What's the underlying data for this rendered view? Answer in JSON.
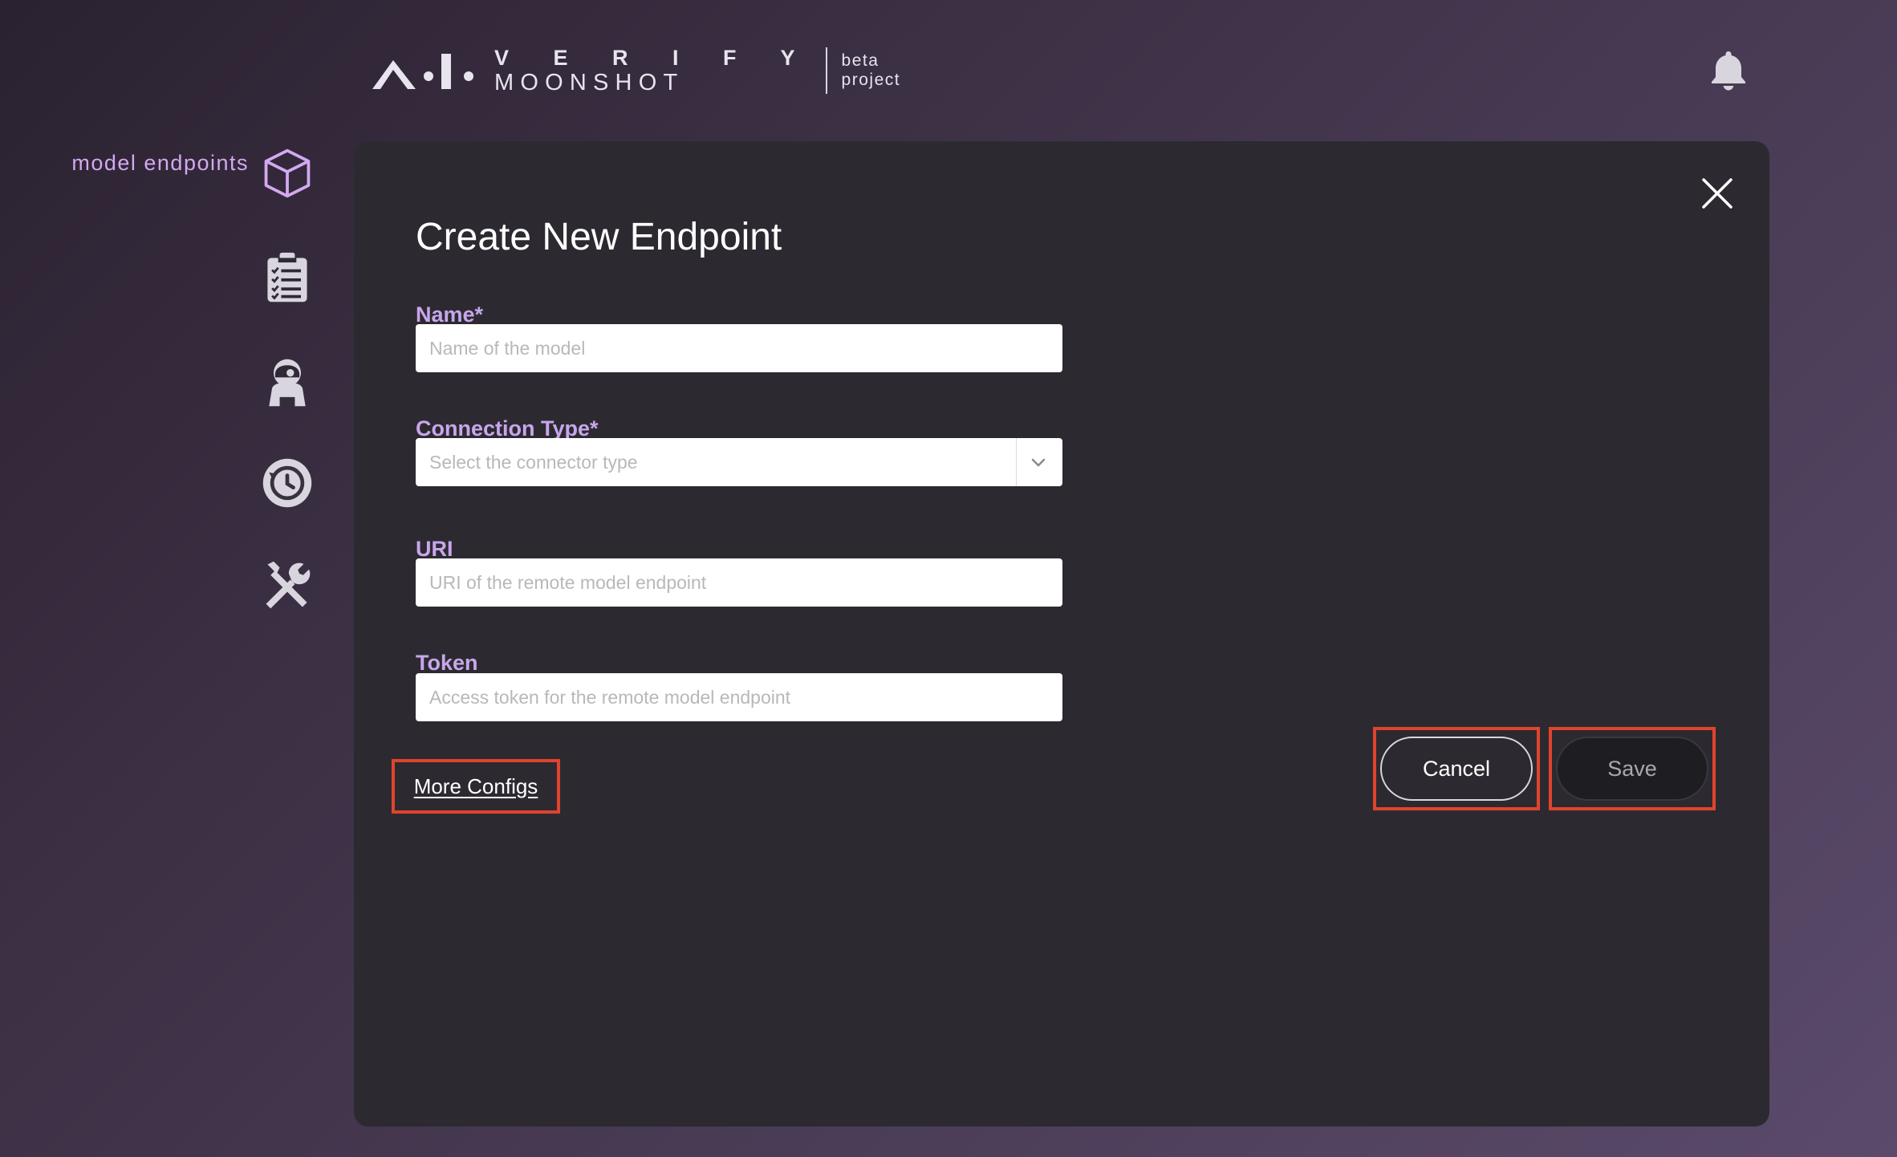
{
  "header": {
    "logo": {
      "line1": "V E R I F Y",
      "line2": "MOONSHOT",
      "tag_line1": "beta",
      "tag_line2": "project"
    },
    "bell_icon": "bell-icon"
  },
  "sidebar": {
    "active_label": "model endpoints",
    "items": [
      {
        "icon": "cube-icon",
        "active": true
      },
      {
        "icon": "clipboard-checklist-icon"
      },
      {
        "icon": "astronaut-icon"
      },
      {
        "icon": "history-clock-icon"
      },
      {
        "icon": "tools-icon"
      }
    ]
  },
  "modal": {
    "title": "Create New Endpoint",
    "close_icon": "close-icon",
    "fields": {
      "name": {
        "label": "Name*",
        "placeholder": "Name of the model",
        "value": ""
      },
      "connection_type": {
        "label": "Connection Type*",
        "placeholder": "Select the connector type",
        "value": ""
      },
      "uri": {
        "label": "URI",
        "placeholder": "URI of the remote model endpoint",
        "value": ""
      },
      "token": {
        "label": "Token",
        "placeholder": "Access token for the remote model endpoint",
        "value": ""
      }
    },
    "more_configs_label": "More Configs",
    "cancel_label": "Cancel",
    "save_label": "Save"
  },
  "colors": {
    "accent": "#c8a6ec",
    "highlight_box": "#e0442c",
    "modal_bg": "#2c2a30"
  }
}
